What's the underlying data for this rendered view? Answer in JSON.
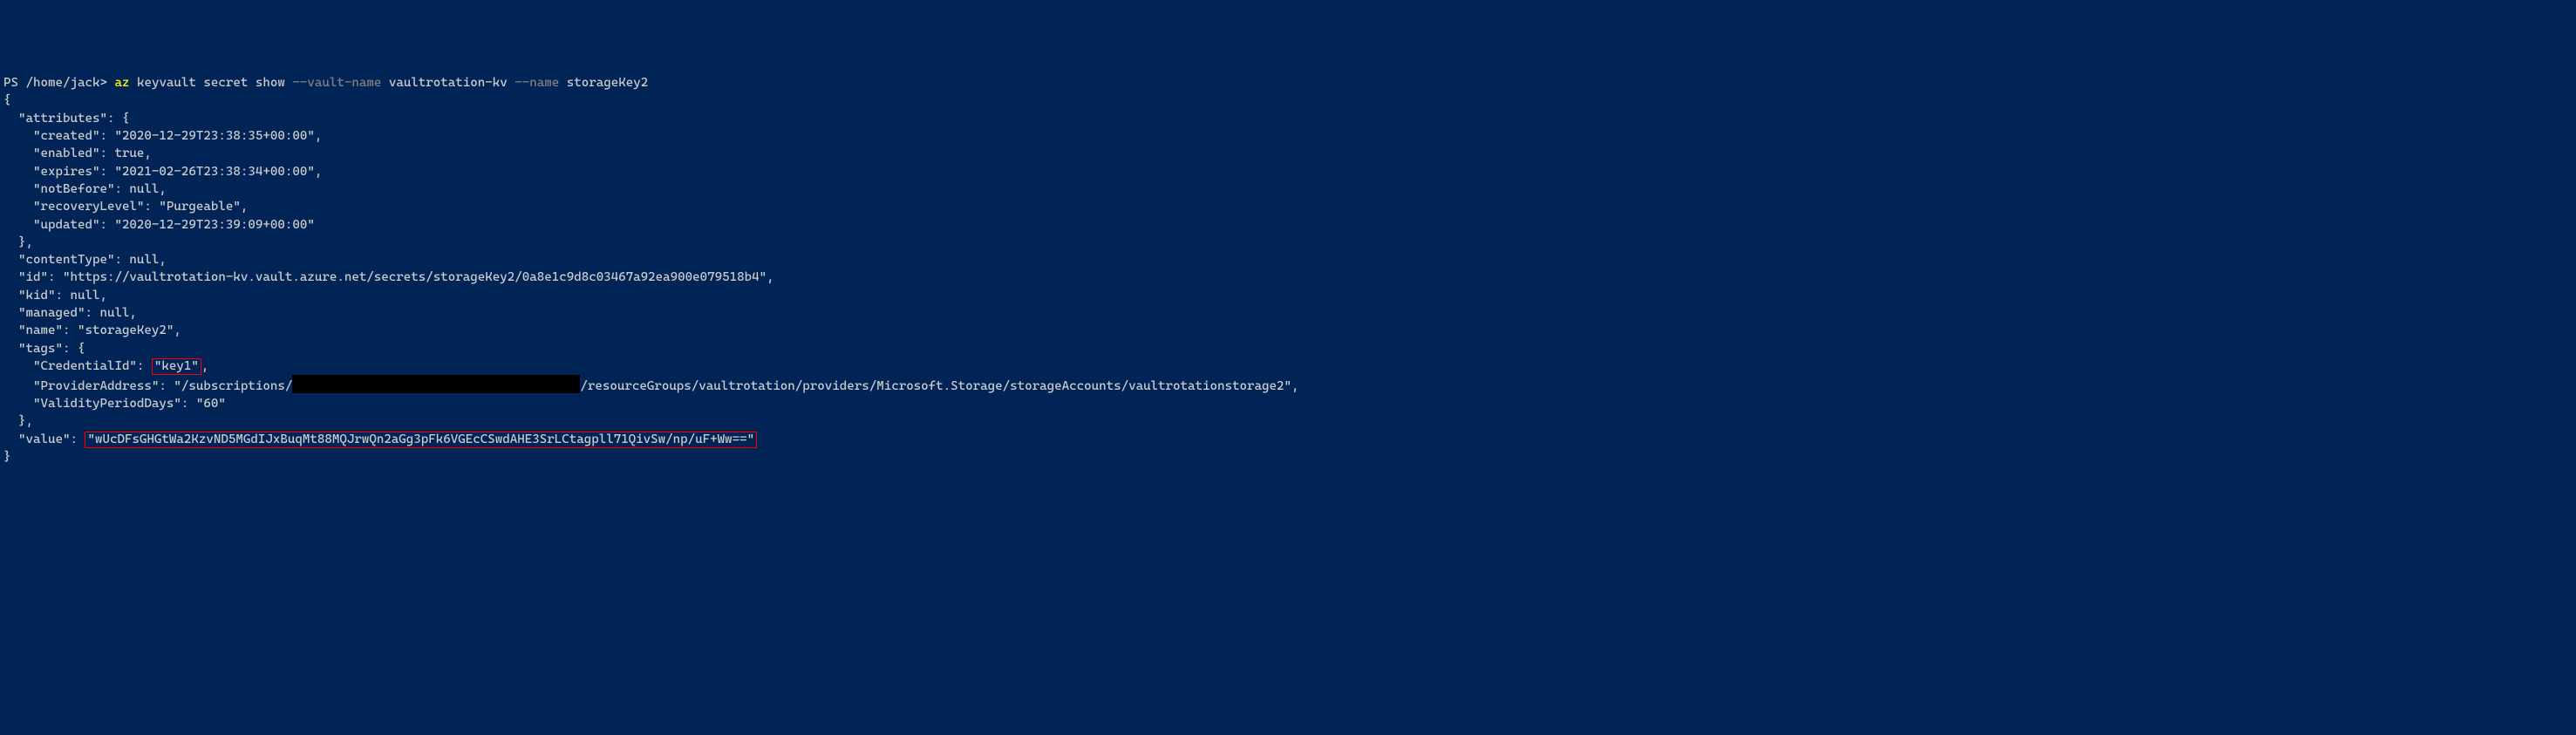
{
  "prompt": {
    "prefix": "PS /home/jack> ",
    "cmd": "az",
    "args1": " keyvault secret show ",
    "flag1": "--vault-name",
    "args2": " vaultrotation-kv ",
    "flag2": "--name",
    "args3": " storageKey2"
  },
  "output": {
    "open": "{",
    "attr_label": "  \"attributes\": {",
    "created": "    \"created\": \"2020-12-29T23:38:35+00:00\",",
    "enabled": "    \"enabled\": true,",
    "expires": "    \"expires\": \"2021-02-26T23:38:34+00:00\",",
    "notBefore": "    \"notBefore\": null,",
    "recoveryLevel": "    \"recoveryLevel\": \"Purgeable\",",
    "updated": "    \"updated\": \"2020-12-29T23:39:09+00:00\"",
    "attr_close": "  },",
    "contentType": "  \"contentType\": null,",
    "id": "  \"id\": \"https://vaultrotation-kv.vault.azure.net/secrets/storageKey2/0a8e1c9d8c03467a92ea900e079518b4\",",
    "kid": "  \"kid\": null,",
    "managed": "  \"managed\": null,",
    "name": "  \"name\": \"storageKey2\",",
    "tags_label": "  \"tags\": {",
    "cred_pre": "    \"CredentialId\": ",
    "cred_val": "\"key1\"",
    "cred_post": ",",
    "provider_pre": "    \"ProviderAddress\": \"/subscriptions/",
    "provider_post": "/resourceGroups/vaultrotation/providers/Microsoft.Storage/storageAccounts/vaultrotationstorage2\",",
    "validity": "    \"ValidityPeriodDays\": \"60\"",
    "tags_close": "  },",
    "value_pre": "  \"value\": ",
    "value_val": "\"wUcDFsGHGtWa2KzvND5MGdIJxBuqMt88MQJrwQn2aGg3pFk6VGEcCSwdAHE3SrLCtagpll71QivSw/np/uF+Ww==\"",
    "close": "}"
  }
}
